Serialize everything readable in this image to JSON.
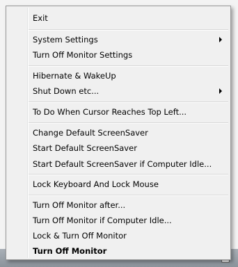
{
  "menu": {
    "items": [
      {
        "label": "Exit"
      },
      {
        "label": "System Settings",
        "submenu": true
      },
      {
        "label": "Turn Off Monitor Settings"
      },
      {
        "label": "Hibernate & WakeUp"
      },
      {
        "label": "Shut Down etc...",
        "submenu": true
      },
      {
        "label": "To Do When Cursor Reaches Top Left..."
      },
      {
        "label": "Change Default ScreenSaver"
      },
      {
        "label": "Start Default ScreenSaver"
      },
      {
        "label": "Start Default ScreenSaver if Computer Idle..."
      },
      {
        "label": "Lock Keyboard And Lock Mouse"
      },
      {
        "label": "Turn Off Monitor after..."
      },
      {
        "label": "Turn Off Monitor if Computer Idle..."
      },
      {
        "label": "Lock & Turn Off Monitor"
      },
      {
        "label": "Turn Off Monitor",
        "default": true
      }
    ]
  },
  "colors": {
    "menu_background": "#f0f0f0",
    "separator": "#d7d7d7",
    "text": "#000000"
  }
}
